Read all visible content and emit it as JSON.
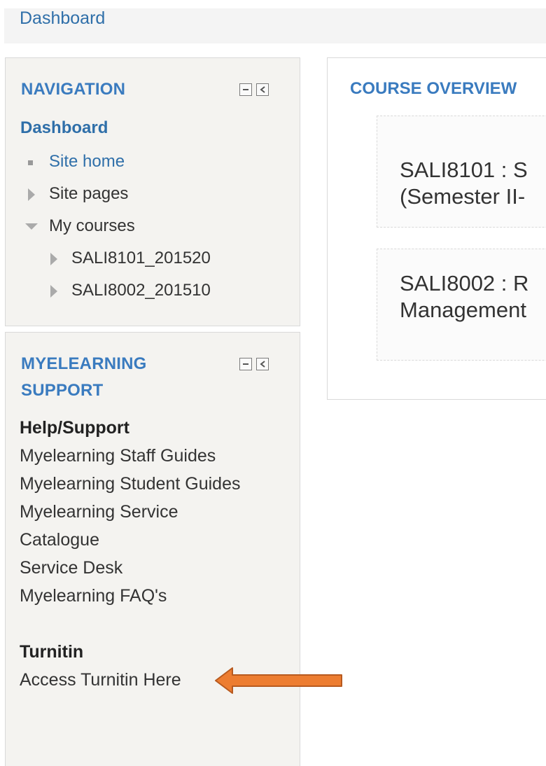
{
  "header": {
    "breadcrumb": "Dashboard"
  },
  "navigation": {
    "title": "NAVIGATION",
    "top": "Dashboard",
    "items": [
      {
        "label": "Site home",
        "marker": "square-bullet-icon",
        "style": "link"
      },
      {
        "label": "Site pages",
        "marker": "triangle-right-icon",
        "style": "plain"
      },
      {
        "label": "My courses",
        "marker": "triangle-down-icon",
        "style": "plain"
      },
      {
        "label": "SALI8101_201520",
        "marker": "triangle-right-icon",
        "style": "plain"
      },
      {
        "label": "SALI8002_201510",
        "marker": "triangle-right-icon",
        "style": "plain"
      }
    ]
  },
  "support": {
    "title_line1": "MYELEARNING",
    "title_line2": "SUPPORT",
    "help_heading": "Help/Support",
    "links": [
      "Myelearning Staff Guides",
      "Myelearning Student Guides",
      "Myelearning Service",
      "Catalogue",
      "Service Desk",
      "Myelearning FAQ's"
    ],
    "turnitin_heading": "Turnitin",
    "turnitin_link": "Access Turnitin Here"
  },
  "overview": {
    "title": "COURSE OVERVIEW",
    "courses": [
      {
        "line1": "SALI8101 : S",
        "line2": "(Semester II-"
      },
      {
        "line1": "SALI8002 : R",
        "line2": "Management"
      }
    ]
  },
  "colors": {
    "link": "#2f6fa9",
    "block_title": "#3a7bbf",
    "arrow": "#ed7d31"
  }
}
